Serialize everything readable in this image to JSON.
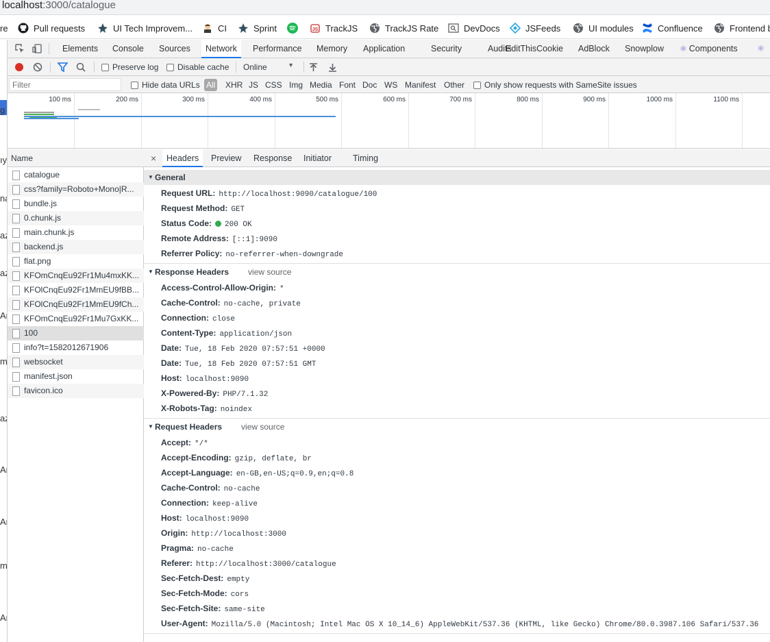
{
  "address_bar": {
    "host": "localhost",
    "rest": ":3000/catalogue"
  },
  "bookmarks": [
    {
      "label": "re",
      "icon": "none"
    },
    {
      "label": "Pull requests",
      "icon": "github-icon"
    },
    {
      "label": "UI Tech Improvem...",
      "icon": "jenkins-icon"
    },
    {
      "label": "CI",
      "icon": "butler-icon"
    },
    {
      "label": "Sprint",
      "icon": "jenkins-icon"
    },
    {
      "label": "",
      "icon": "spotify-icon"
    },
    {
      "label": "TrackJS",
      "icon": "trackjs-icon"
    },
    {
      "label": "TrackJS Rate",
      "icon": "globe-icon"
    },
    {
      "label": "DevDocs",
      "icon": "devdocs-icon"
    },
    {
      "label": "JSFeeds",
      "icon": "jsfeeds-icon"
    },
    {
      "label": "UI modules",
      "icon": "globe-icon"
    },
    {
      "label": "Confluence",
      "icon": "confluence-icon"
    },
    {
      "label": "Frontend b",
      "icon": "globe-icon"
    }
  ],
  "page_fragments": [
    "g",
    "ıy",
    "na",
    "az",
    "az",
    "An",
    "m",
    "az",
    "An",
    "An",
    "m",
    "An"
  ],
  "devtools": {
    "tabs": [
      "Elements",
      "Console",
      "Sources",
      "Network",
      "Performance",
      "Memory",
      "Application",
      "Security",
      "Audits",
      "EditThisCookie",
      "AdBlock",
      "Snowplow",
      "Components"
    ],
    "active_tab": "Network",
    "toolbar": {
      "preserve_log": "Preserve log",
      "disable_cache": "Disable cache",
      "throttle": "Online"
    },
    "filter": {
      "placeholder": "Filter",
      "hide_data_urls": "Hide data URLs",
      "types": [
        "All",
        "XHR",
        "JS",
        "CSS",
        "Img",
        "Media",
        "Font",
        "Doc",
        "WS",
        "Manifest",
        "Other"
      ],
      "active_type": "All",
      "samesite": "Only show requests with SameSite issues"
    },
    "timeline_ticks": [
      "100 ms",
      "200 ms",
      "300 ms",
      "400 ms",
      "500 ms",
      "600 ms",
      "700 ms",
      "800 ms",
      "900 ms",
      "1000 ms",
      "1100 ms"
    ],
    "colors": {
      "accent": "#1a73e8",
      "record": "#d93025",
      "status_ok": "#34a853",
      "waterfall_green": "#4caf50",
      "waterfall_blue": "#4a90d9"
    }
  },
  "requests": {
    "header": "Name",
    "rows": [
      "catalogue",
      "css?family=Roboto+Mono|R...",
      "bundle.js",
      "0.chunk.js",
      "main.chunk.js",
      "backend.js",
      "flat.png",
      "KFOmCnqEu92Fr1Mu4mxKK...",
      "KFOlCnqEu92Fr1MmEU9fBB...",
      "KFOlCnqEu92Fr1MmEU9fCh...",
      "KFOmCnqEu92Fr1Mu7GxKK...",
      "100",
      "info?t=1582012671906",
      "websocket",
      "manifest.json",
      "favicon.ico"
    ],
    "selected": "100"
  },
  "details": {
    "close": "×",
    "tabs": [
      "Headers",
      "Preview",
      "Response",
      "Initiator",
      "Timing"
    ],
    "active_tab": "Headers",
    "general": {
      "title": "General",
      "rows": [
        {
          "k": "Request URL:",
          "v": "http://localhost:9090/catalogue/100"
        },
        {
          "k": "Request Method:",
          "v": "GET"
        },
        {
          "k": "Status Code:",
          "v": "200 OK"
        },
        {
          "k": "Remote Address:",
          "v": "[::1]:9090"
        },
        {
          "k": "Referrer Policy:",
          "v": "no-referrer-when-downgrade"
        }
      ]
    },
    "response_headers": {
      "title": "Response Headers",
      "view_source": "view source",
      "rows": [
        {
          "k": "Access-Control-Allow-Origin:",
          "v": "*"
        },
        {
          "k": "Cache-Control:",
          "v": "no-cache, private"
        },
        {
          "k": "Connection:",
          "v": "close"
        },
        {
          "k": "Content-Type:",
          "v": "application/json"
        },
        {
          "k": "Date:",
          "v": "Tue, 18 Feb 2020 07:57:51 +0000"
        },
        {
          "k": "Date:",
          "v": "Tue, 18 Feb 2020 07:57:51 GMT"
        },
        {
          "k": "Host:",
          "v": "localhost:9090"
        },
        {
          "k": "X-Powered-By:",
          "v": "PHP/7.1.32"
        },
        {
          "k": "X-Robots-Tag:",
          "v": "noindex"
        }
      ]
    },
    "request_headers": {
      "title": "Request Headers",
      "view_source": "view source",
      "rows": [
        {
          "k": "Accept:",
          "v": "*/*"
        },
        {
          "k": "Accept-Encoding:",
          "v": "gzip, deflate, br"
        },
        {
          "k": "Accept-Language:",
          "v": "en-GB,en-US;q=0.9,en;q=0.8"
        },
        {
          "k": "Cache-Control:",
          "v": "no-cache"
        },
        {
          "k": "Connection:",
          "v": "keep-alive"
        },
        {
          "k": "Host:",
          "v": "localhost:9090"
        },
        {
          "k": "Origin:",
          "v": "http://localhost:3000"
        },
        {
          "k": "Pragma:",
          "v": "no-cache"
        },
        {
          "k": "Referer:",
          "v": "http://localhost:3000/catalogue"
        },
        {
          "k": "Sec-Fetch-Dest:",
          "v": "empty"
        },
        {
          "k": "Sec-Fetch-Mode:",
          "v": "cors"
        },
        {
          "k": "Sec-Fetch-Site:",
          "v": "same-site"
        },
        {
          "k": "User-Agent:",
          "v": "Mozilla/5.0 (Macintosh; Intel Mac OS X 10_14_6) AppleWebKit/537.36 (KHTML, like Gecko) Chrome/80.0.3987.106 Safari/537.36"
        }
      ]
    }
  }
}
